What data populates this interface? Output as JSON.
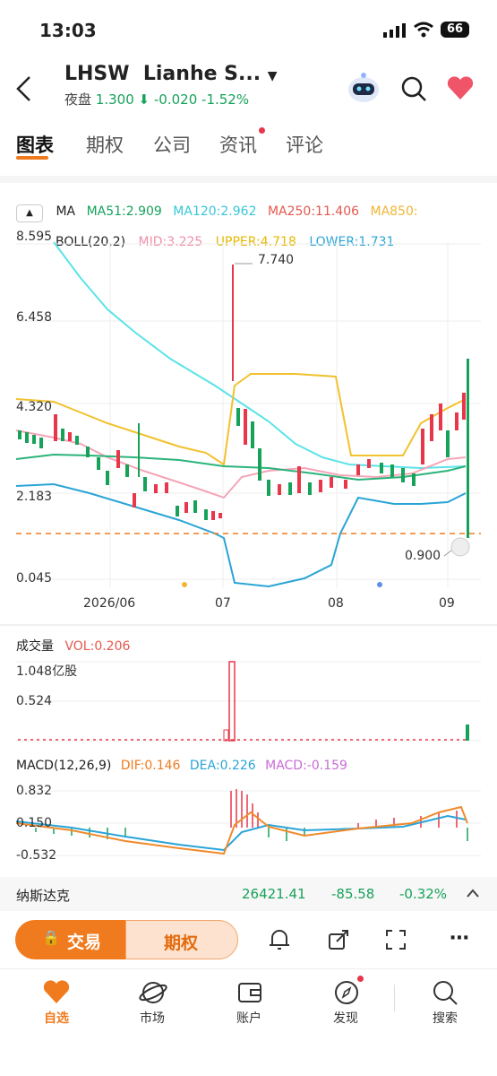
{
  "status": {
    "time": "13:03",
    "battery": "66"
  },
  "header": {
    "ticker": "LHSW",
    "name": "Lianhe S...",
    "session_label": "夜盘",
    "price": "1.300",
    "change": "-0.020",
    "change_pct": "-1.52%"
  },
  "tabs": [
    "图表",
    "期权",
    "公司",
    "资讯",
    "评论"
  ],
  "legend": {
    "ma_label": "MA",
    "ma51": "MA51:2.909",
    "ma120": "MA120:2.962",
    "ma250": "MA250:11.406",
    "ma850": "MA850:",
    "boll": "BOLL(20,2)",
    "mid": "MID:3.225",
    "upper": "UPPER:4.718",
    "lower": "LOWER:1.731"
  },
  "price_axis": [
    "8.595",
    "6.458",
    "4.320",
    "2.183",
    "0.045"
  ],
  "annotations": {
    "high": "7.740",
    "low": "0.900"
  },
  "date_axis": [
    "2026/06",
    "07",
    "08",
    "09"
  ],
  "volume": {
    "title": "成交量",
    "vol": "VOL:0.206",
    "axis": [
      "1.048亿股",
      "0.524"
    ]
  },
  "macd": {
    "title": "MACD(12,26,9)",
    "dif": "DIF:0.146",
    "dea": "DEA:0.226",
    "macd": "MACD:-0.159",
    "axis": [
      "0.832",
      "0.150",
      "-0.532"
    ]
  },
  "index_bar": {
    "name": "纳斯达克",
    "value": "26421.41",
    "change": "-85.58",
    "pct": "-0.32%"
  },
  "actions": {
    "trade": "交易",
    "options": "期权"
  },
  "nav": [
    "自选",
    "市场",
    "账户",
    "发现",
    "搜索"
  ],
  "colors": {
    "up": "#e8364a",
    "down": "#17a25a",
    "accent": "#f07b1e"
  }
}
